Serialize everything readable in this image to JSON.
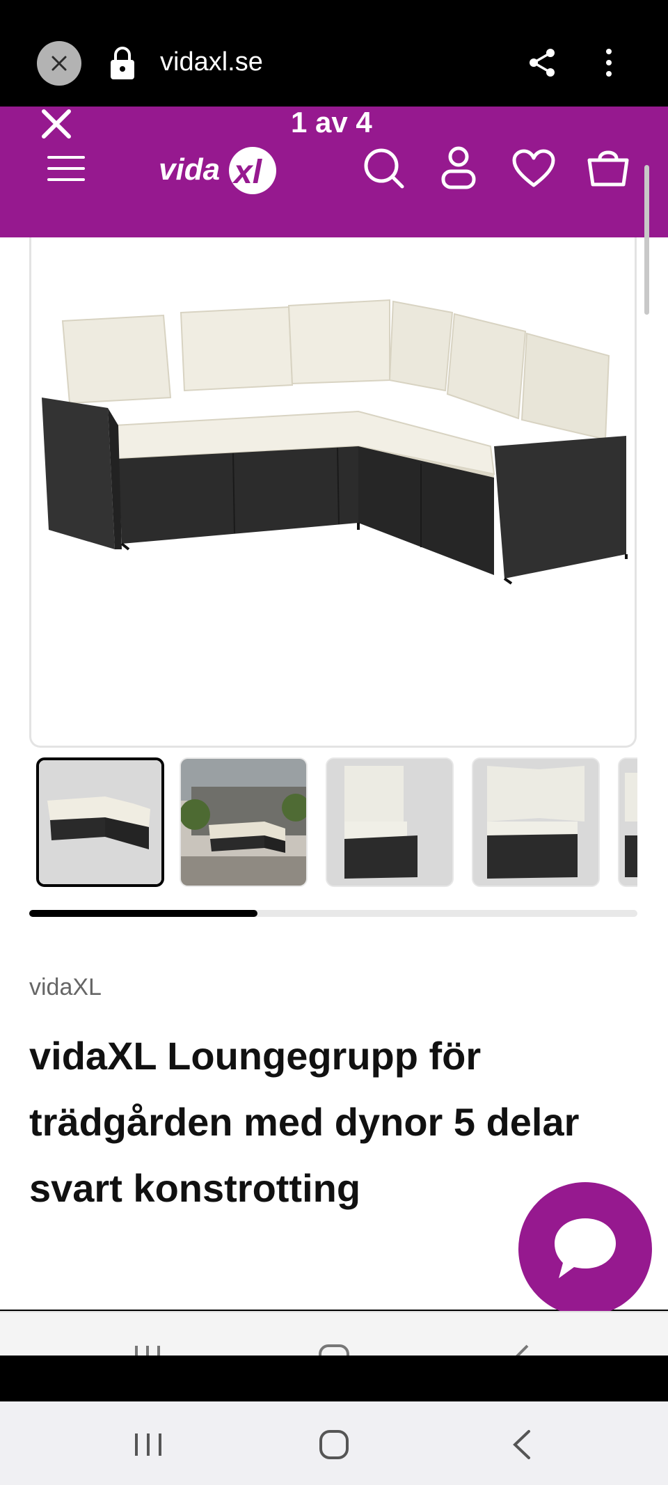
{
  "browser": {
    "url": "vidaxl.se"
  },
  "viewer": {
    "counter": "1 av 4"
  },
  "header": {
    "logo_text": "vidaXL",
    "brand_color": "#96198f",
    "icons": [
      "menu-icon",
      "search-icon",
      "user-icon",
      "heart-icon",
      "cart-icon"
    ]
  },
  "gallery": {
    "thumbnail_count_visible": 5,
    "active_index": 0,
    "progress_fraction": 0.375
  },
  "product": {
    "brand": "vidaXL",
    "title": "vidaXL Loungegrupp för trädgården med dynor 5 delar svart konstrotting"
  },
  "chat": {
    "icon": "chat-icon"
  },
  "system_nav": {
    "icons": [
      "recent-apps-icon",
      "home-icon",
      "back-icon"
    ]
  }
}
